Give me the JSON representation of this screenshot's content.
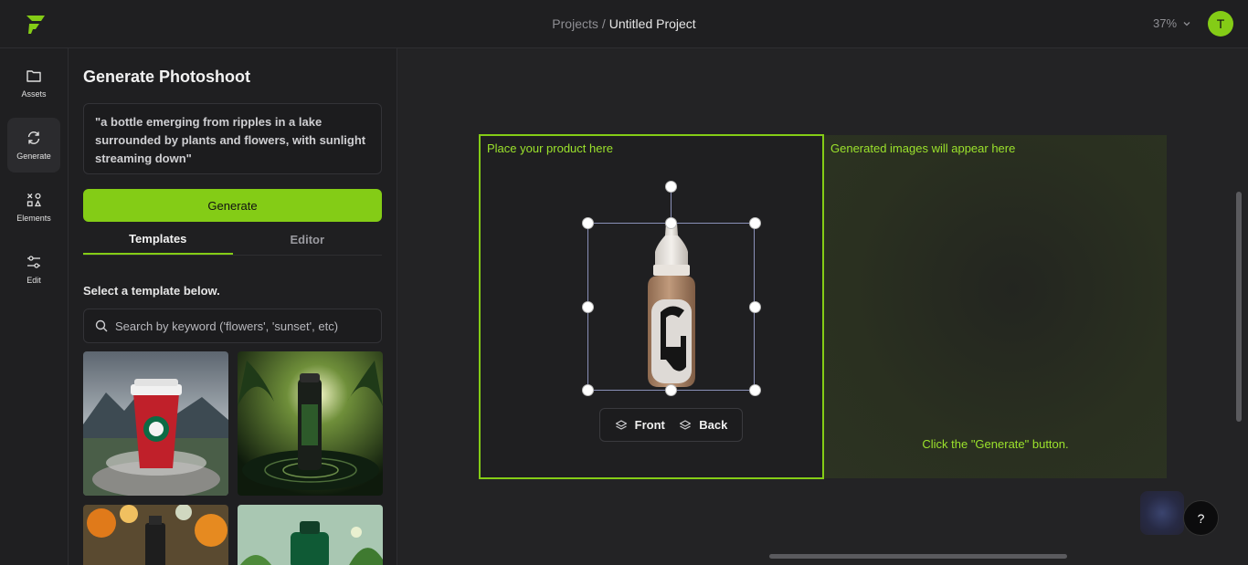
{
  "header": {
    "breadcrumb_parent": "Projects",
    "breadcrumb_sep": "/",
    "breadcrumb_current": "Untitled Project",
    "zoom": "37%",
    "avatar_initial": "T",
    "accent": "#84cc16"
  },
  "rail": {
    "items": [
      {
        "label": "Assets",
        "icon": "folder-icon"
      },
      {
        "label": "Generate",
        "icon": "refresh-icon"
      },
      {
        "label": "Elements",
        "icon": "shapes-icon"
      },
      {
        "label": "Edit",
        "icon": "sliders-icon"
      }
    ]
  },
  "panel": {
    "title": "Generate Photoshoot",
    "prompt": "\"a bottle emerging from ripples in a lake surrounded by plants and flowers, with sunlight streaming down\"",
    "generate_label": "Generate",
    "tabs": [
      "Templates",
      "Editor"
    ],
    "select_label": "Select a template below.",
    "search_placeholder": "Search by keyword ('flowers', 'sunset', etc)"
  },
  "canvas": {
    "place_label": "Place your product here",
    "generated_label": "Generated images will appear here",
    "generated_hint": "Click the \"Generate\" button.",
    "front_label": "Front",
    "back_label": "Back"
  },
  "help_label": "?"
}
